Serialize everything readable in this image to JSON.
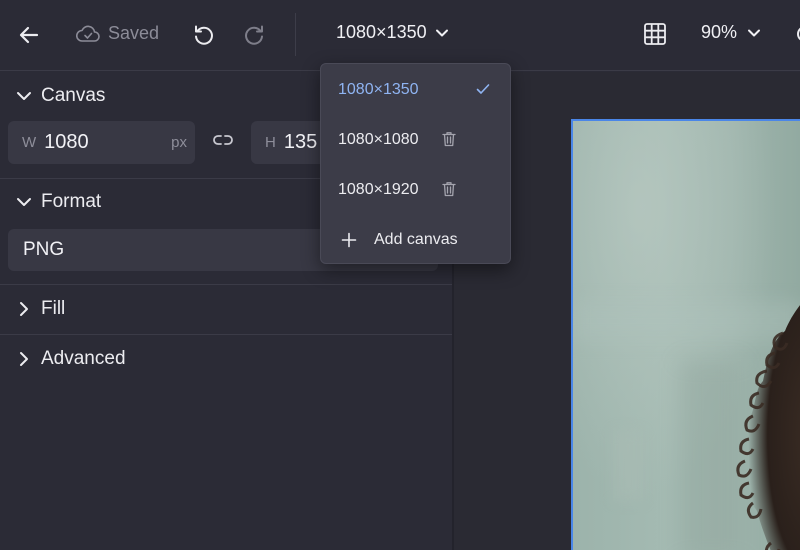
{
  "toolbar": {
    "saved_label": "Saved",
    "canvas_size": "1080×1350",
    "zoom": "90%"
  },
  "sidebar": {
    "canvas": {
      "title": "Canvas",
      "width_label": "W",
      "width_value": "1080",
      "width_unit": "px",
      "height_label": "H",
      "height_value": "135"
    },
    "format": {
      "title": "Format",
      "value": "PNG"
    },
    "fill": {
      "title": "Fill"
    },
    "advanced": {
      "title": "Advanced"
    }
  },
  "size_menu": {
    "items": [
      {
        "label": "1080×1350",
        "selected": true
      },
      {
        "label": "1080×1080",
        "deletable": true
      },
      {
        "label": "1080×1920",
        "deletable": true
      }
    ],
    "add_label": "Add canvas"
  },
  "colors": {
    "background": "#2b2b36",
    "panel_field": "#383844",
    "accent_selected": "#8fb4f2",
    "artboard_border": "#4a86e8"
  },
  "icons": {
    "back": "arrow-left-icon",
    "saved": "cloud-check-icon",
    "undo": "undo-icon",
    "redo": "redo-icon",
    "grid": "grid-icon",
    "link": "link-icon",
    "check": "check-icon",
    "trash": "trash-icon",
    "plus": "plus-icon"
  }
}
